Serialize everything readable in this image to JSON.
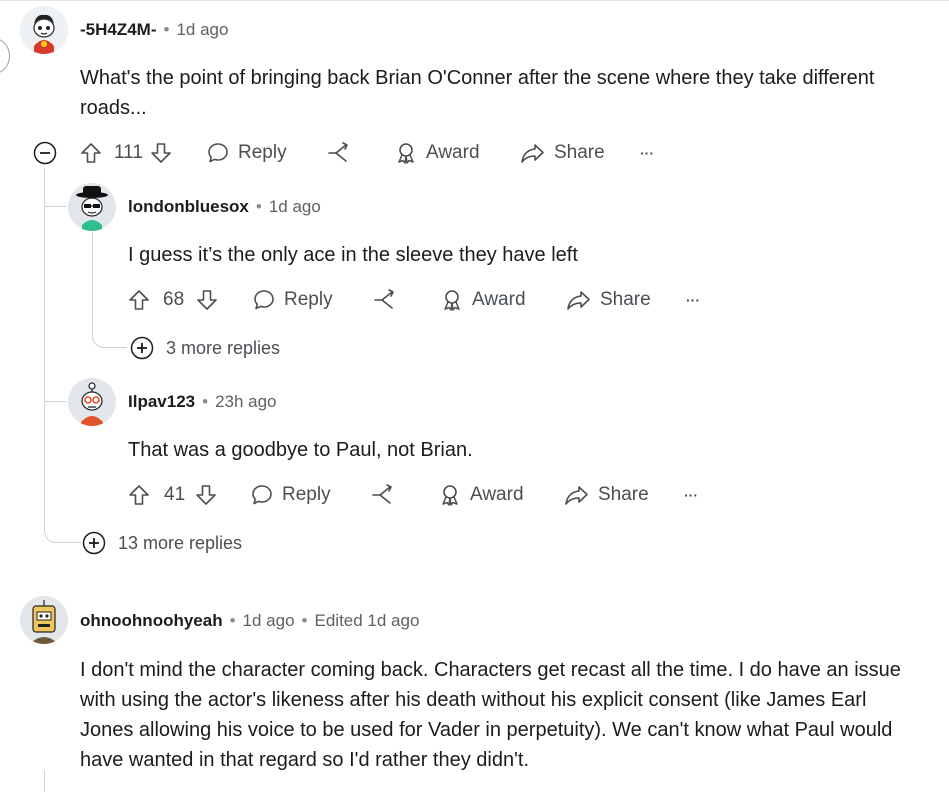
{
  "comments": [
    {
      "author": "-5H4Z4M-",
      "time": "1d ago",
      "body": "What's the point of bringing back Brian O'Conner after the scene where they take different roads...",
      "votes": "111",
      "reply_label": "Reply",
      "award_label": "Award",
      "share_label": "Share",
      "more_label": "···",
      "replies": [
        {
          "author": "londonbluesox",
          "time": "1d ago",
          "body": "I guess it’s the only ace in the sleeve they have left",
          "votes": "68",
          "reply_label": "Reply",
          "award_label": "Award",
          "share_label": "Share",
          "more_label": "···",
          "more_replies": "3 more replies"
        },
        {
          "author": "Ilpav123",
          "time": "23h ago",
          "body": "That was a goodbye to Paul, not Brian.",
          "votes": "41",
          "reply_label": "Reply",
          "award_label": "Award",
          "share_label": "Share",
          "more_label": "···"
        }
      ],
      "more_replies": "13 more replies"
    },
    {
      "author": "ohnoohnoohyeah",
      "time": "1d ago",
      "edited": "Edited 1d ago",
      "body_lines": [
        "I don't mind the character coming back. Characters get recast all the time. I do have an issue",
        "with using the actor's likeness after his death without his explicit consent (like James Earl",
        "Jones allowing his voice to be used for Vader in perpetuity). We can't know what Paul would",
        "have wanted in that regard so I'd rather they didn't."
      ]
    }
  ],
  "colors": {
    "text": "#1c1c1c",
    "muted": "#5c6166",
    "thread_line": "#d0d0d0"
  },
  "icons": [
    "upvote-icon",
    "downvote-icon",
    "reply-icon",
    "share-icon",
    "award-icon",
    "more-icon",
    "collapse-icon",
    "expand-icon"
  ]
}
